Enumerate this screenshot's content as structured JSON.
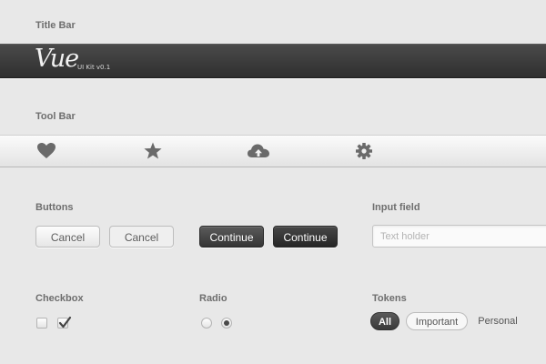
{
  "title_bar": {
    "section_label": "Title Bar",
    "logo": "Vue",
    "kit_label": "UI Kit v0.1"
  },
  "tool_bar": {
    "section_label": "Tool Bar",
    "icons": [
      "heart-icon",
      "star-icon",
      "cloud-upload-icon",
      "gear-icon"
    ]
  },
  "buttons": {
    "section_label": "Buttons",
    "cancel_1": "Cancel",
    "cancel_2": "Cancel",
    "continue_1": "Continue",
    "continue_2": "Continue"
  },
  "input_field": {
    "section_label": "Input field",
    "placeholder": "Text holder",
    "value": ""
  },
  "checkbox": {
    "section_label": "Checkbox",
    "items": [
      false,
      true
    ]
  },
  "radio": {
    "section_label": "Radio",
    "selected_index": 1
  },
  "tokens": {
    "section_label": "Tokens",
    "items": [
      "All",
      "Important",
      "Personal"
    ],
    "active_index": 0
  },
  "colors": {
    "background": "#e8e8e8",
    "dark_bar": "#333333",
    "icon": "#6a6a6a"
  }
}
